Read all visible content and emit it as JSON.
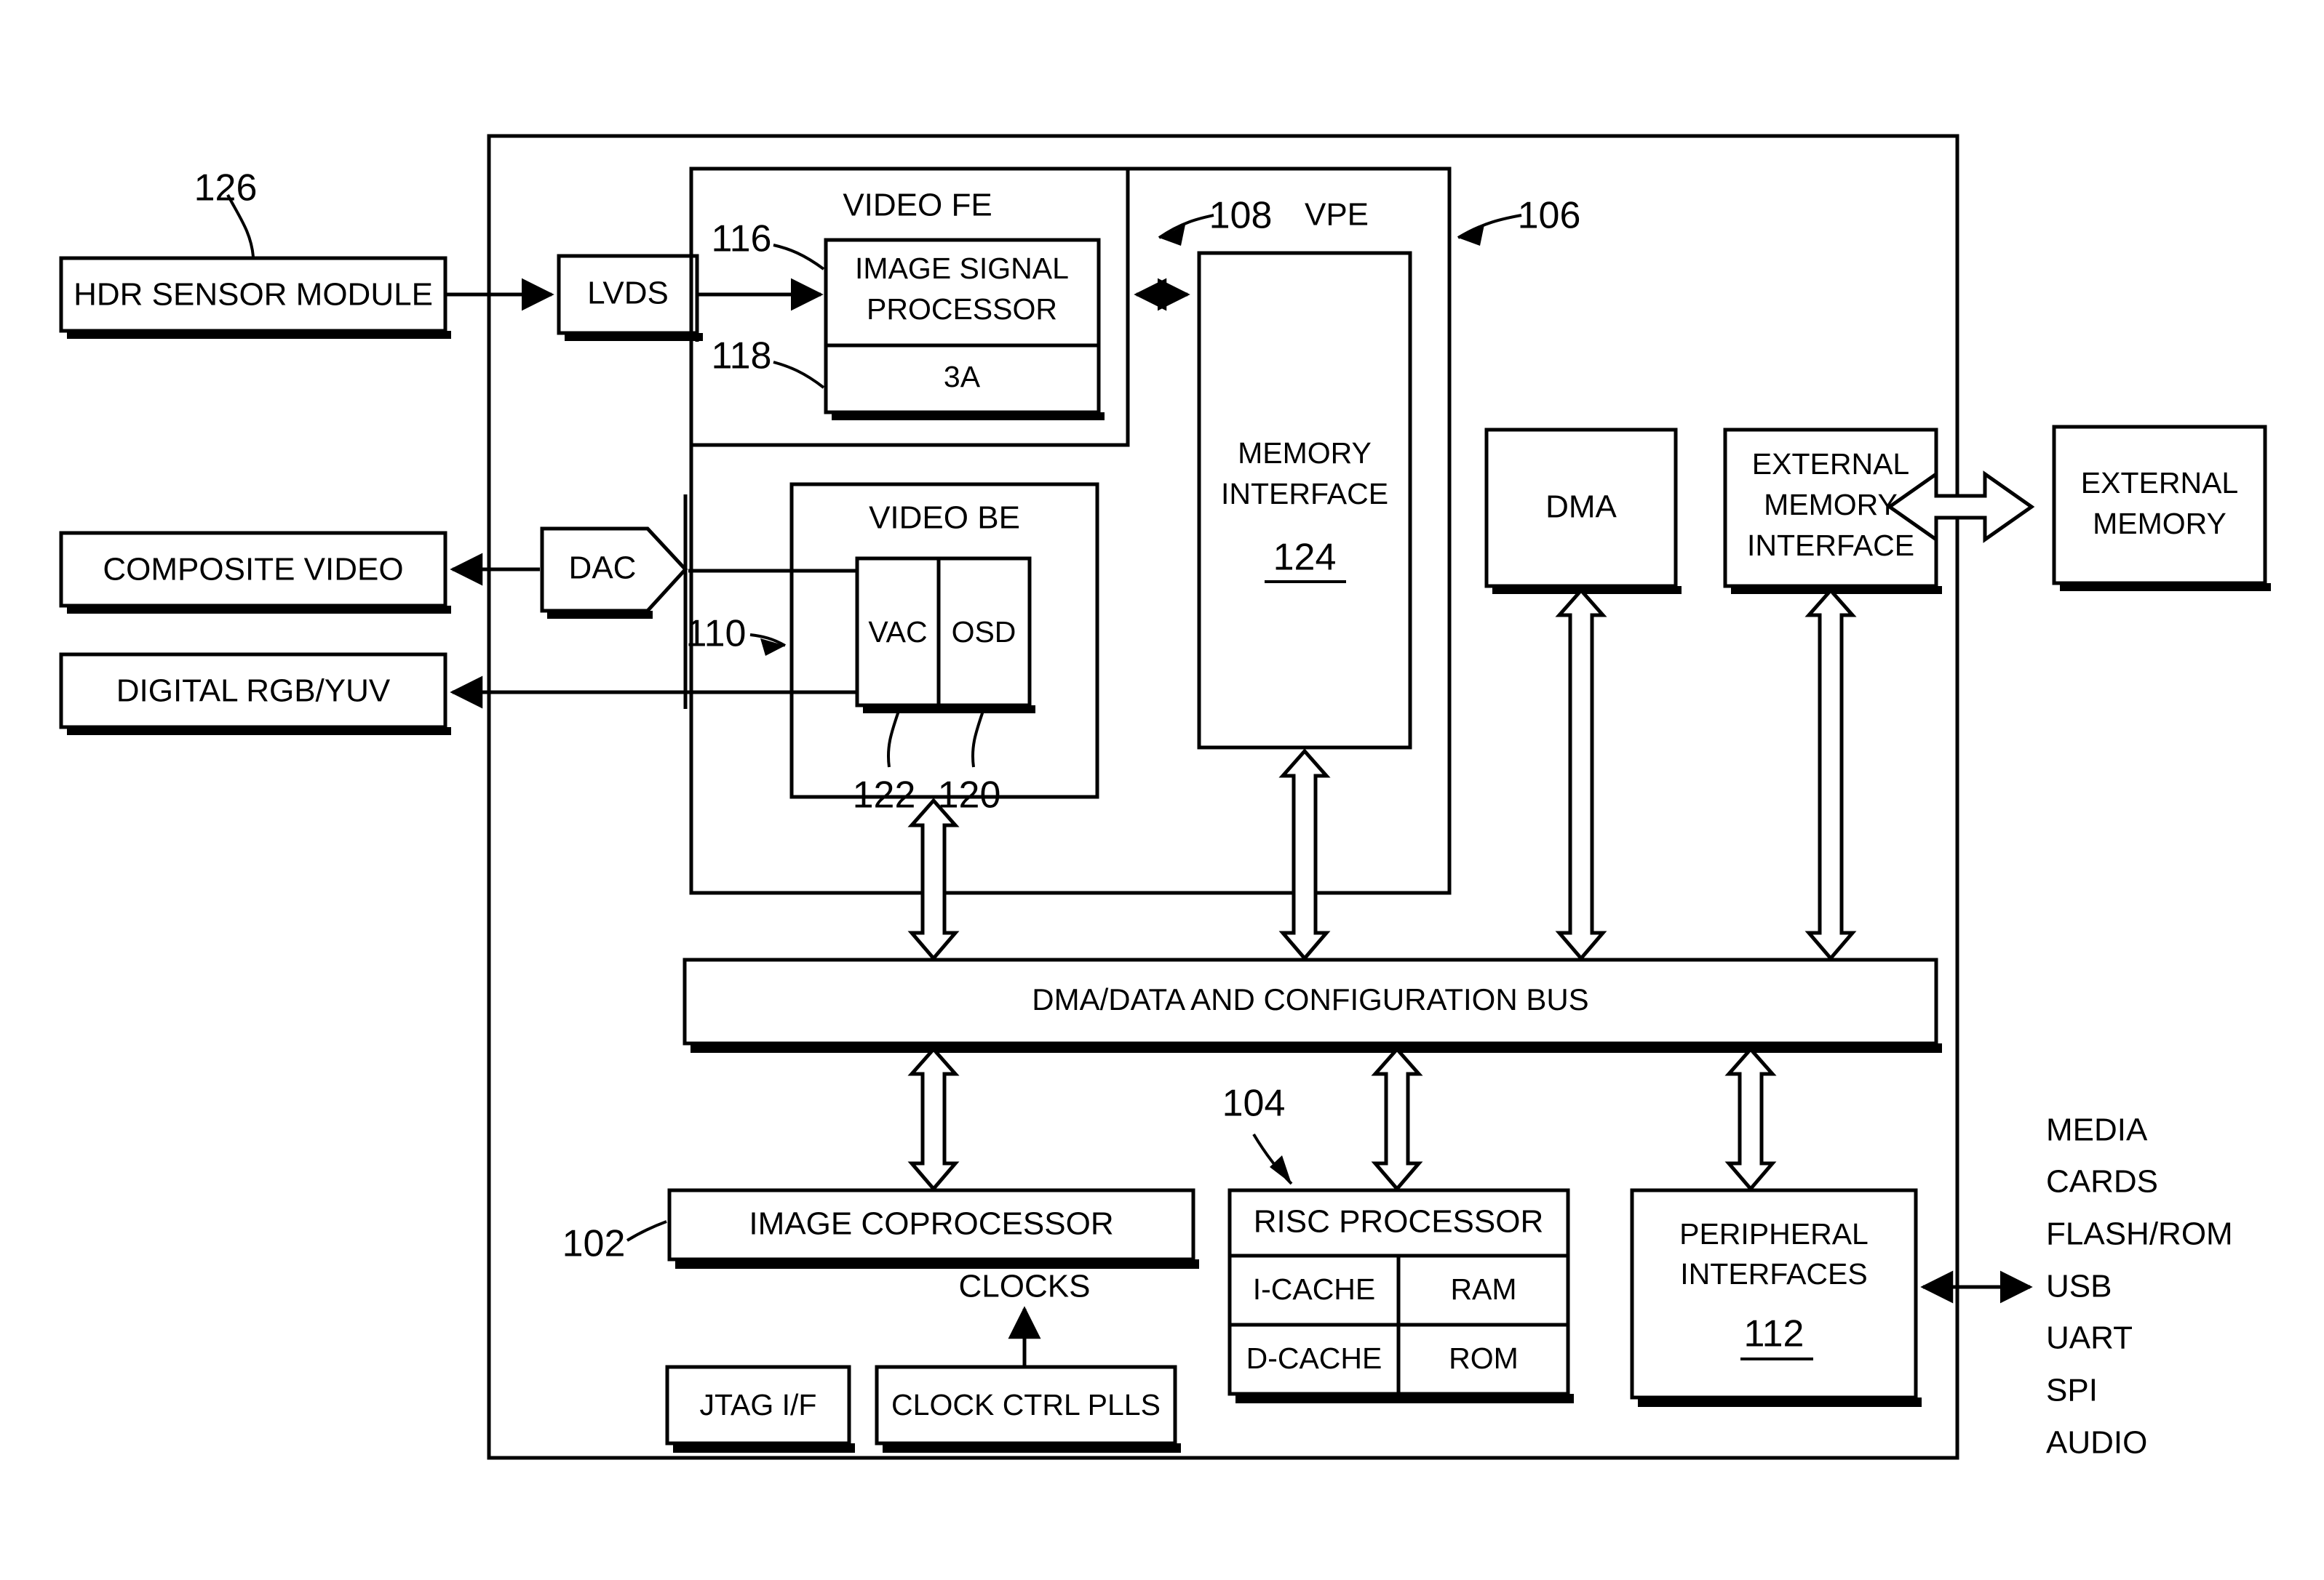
{
  "figure": {
    "type": "patent-block-diagram",
    "title": "Imaging system-on-chip block diagram"
  },
  "external_blocks": {
    "hdr_sensor": "HDR SENSOR MODULE",
    "composite_video": "COMPOSITE VIDEO",
    "digital_rgb": "DIGITAL RGB/YUV",
    "external_memory": "EXTERNAL MEMORY"
  },
  "chip": {
    "lvds": "LVDS",
    "dac": "DAC",
    "vpe_label": "VPE",
    "video_fe_label": "VIDEO FE",
    "video_be_label": "VIDEO BE",
    "image_signal_processor": "IMAGE SIGNAL PROCESSOR",
    "isp_line1": "IMAGE SIGNAL",
    "isp_line2": "PROCESSOR",
    "three_a": "3A",
    "vac": "VAC",
    "osd": "OSD",
    "memory_interface_line1": "MEMORY",
    "memory_interface_line2": "INTERFACE",
    "memory_interface_ref": "124",
    "dma": "DMA",
    "external_memory_interface_line1": "EXTERNAL",
    "external_memory_interface_line2": "MEMORY",
    "external_memory_interface_line3": "INTERFACE",
    "bus": "DMA/DATA AND CONFIGURATION BUS",
    "image_coprocessor": "IMAGE COPROCESSOR",
    "risc_processor": "RISC PROCESSOR",
    "i_cache": "I-CACHE",
    "ram": "RAM",
    "d_cache": "D-CACHE",
    "rom": "ROM",
    "peripheral_interfaces_line1": "PERIPHERAL",
    "peripheral_interfaces_line2": "INTERFACES",
    "peripheral_interfaces_ref": "112",
    "clocks": "CLOCKS",
    "jtag": "JTAG I/F",
    "clock_ctrl_plls": "CLOCK CTRL PLLS"
  },
  "reference_numerals": {
    "sensor": "126",
    "isp": "116",
    "three_a": "118",
    "vpe_inner": "108",
    "vpe_outer": "106",
    "video_be": "110",
    "vac": "122",
    "osd": "120",
    "memory_interface": "124",
    "image_coprocessor": "102",
    "risc_processor": "104",
    "peripheral_interfaces": "112"
  },
  "peripheral_list": [
    "MEDIA",
    "CARDS",
    "FLASH/ROM",
    "USB",
    "UART",
    "SPI",
    "AUDIO"
  ],
  "colors": {
    "line": "#000000",
    "background": "#ffffff"
  }
}
